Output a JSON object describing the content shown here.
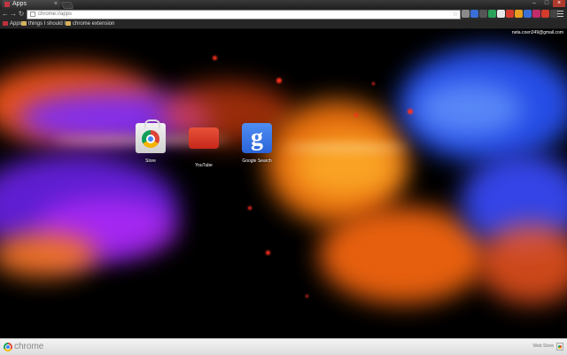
{
  "tab": {
    "title": "Apps",
    "close": "×"
  },
  "window": {
    "minimize": "–",
    "maximize": "□",
    "close": "×"
  },
  "nav": {
    "back": "←",
    "forward": "→",
    "reload": "↻"
  },
  "omnibox": {
    "url": "chrome://apps",
    "star": "☆"
  },
  "bookmarks": [
    {
      "label": "Apps",
      "icon": "apps-grid-icon"
    },
    {
      "label": "things I should l...",
      "icon": "folder-icon"
    },
    {
      "label": "chrome extension",
      "icon": "folder-icon"
    }
  ],
  "account": {
    "email": "neta.coen349@gmail.com"
  },
  "apps": [
    {
      "label": "Store",
      "icon": "chrome-web-store-icon"
    },
    {
      "label": "YouTube",
      "icon": "youtube-icon"
    },
    {
      "label": "Google Search",
      "icon": "google-search-icon",
      "glyph": "g"
    }
  ],
  "bottom_bar": {
    "brand": "chrome",
    "webstore_label": "Web Store"
  },
  "extension_colors": [
    "#8a8a8a",
    "#3b6fd8",
    "#555555",
    "#2aa35a",
    "#e8e8e8",
    "#d33b2c",
    "#e8a020",
    "#3b6fd8",
    "#c12c6a",
    "#d33b2c",
    "#444444"
  ]
}
